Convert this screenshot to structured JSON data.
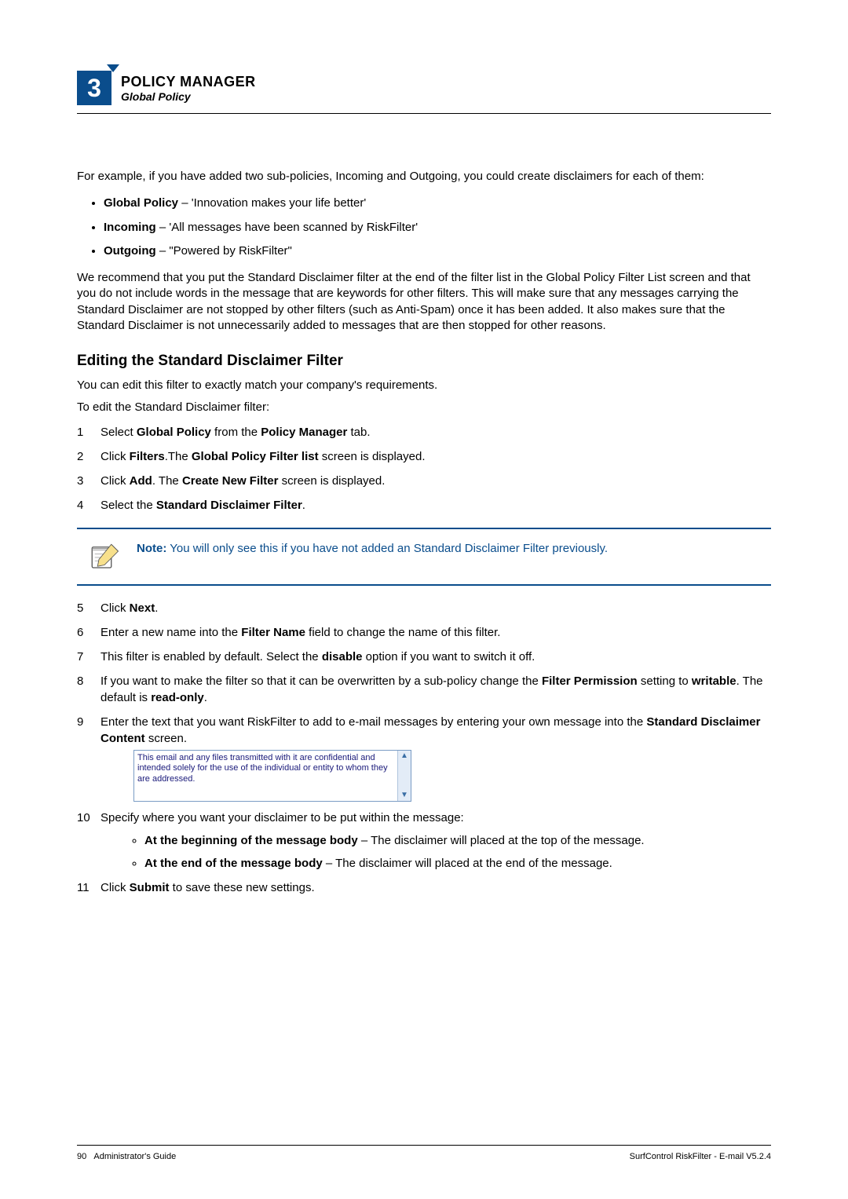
{
  "header": {
    "chapter_number": "3",
    "title": "POLICY MANAGER",
    "subtitle": "Global Policy"
  },
  "intro_para": "For example, if you have added two sub-policies, Incoming and Outgoing, you could create disclaimers for each of them:",
  "bullets1": [
    {
      "bold": "Global Policy",
      "rest": " – 'Innovation makes your life better'"
    },
    {
      "bold": "Incoming",
      "rest": " – 'All messages have been scanned by RiskFilter'"
    },
    {
      "bold": "Outgoing",
      "rest": " – \"Powered by RiskFilter\""
    }
  ],
  "para2": "We recommend that you put the Standard Disclaimer filter at the end of the filter list in the Global Policy Filter List screen and that you do not include words in the message that are keywords for other filters. This will make sure that any messages carrying the Standard Disclaimer are not stopped by other filters (such as Anti-Spam) once it has been added. It also makes sure that the Standard Disclaimer is not unnecessarily added to messages that are then stopped for other reasons.",
  "h2": "Editing the Standard Disclaimer Filter",
  "para3": "You can edit this filter to exactly match your company's requirements.",
  "para4": "To edit the Standard Disclaimer filter:",
  "steps_a": {
    "s1_pre": "Select ",
    "s1_b1": "Global Policy",
    "s1_mid": " from the ",
    "s1_b2": "Policy Manager",
    "s1_post": " tab.",
    "s2_pre": "Click ",
    "s2_b1": "Filters",
    "s2_mid": ".The ",
    "s2_b2": "Global Policy Filter list",
    "s2_post": " screen is displayed.",
    "s3_pre": "Click ",
    "s3_b1": "Add",
    "s3_mid": ". The ",
    "s3_b2": "Create New Filter",
    "s3_post": " screen is displayed.",
    "s4_pre": "Select the ",
    "s4_b1": "Standard Disclaimer Filter",
    "s4_post": "."
  },
  "note": {
    "label": "Note:",
    "text": " You will only see this if you have not added an Standard Disclaimer Filter previously."
  },
  "steps_b": {
    "s5_pre": "Click ",
    "s5_b1": "Next",
    "s5_post": ".",
    "s6_pre": "Enter a new name into the ",
    "s6_b1": "Filter Name",
    "s6_post": " field to change the name of this filter.",
    "s7_pre": "This filter is enabled by default. Select the ",
    "s7_b1": "disable",
    "s7_post": " option if you want to switch it off.",
    "s8_pre": "If you want to make the filter so that it can be overwritten by a sub-policy change the ",
    "s8_b1": "Filter Permission",
    "s8_mid": " setting to ",
    "s8_b2": "writable",
    "s8_mid2": ". The default is ",
    "s8_b3": "read-only",
    "s8_post": ".",
    "s9_pre": "Enter the text that you want RiskFilter to add to e-mail messages by entering your own message into the ",
    "s9_b1": "Standard Disclaimer Content",
    "s9_post": " screen."
  },
  "textarea_content": "This email and any files transmitted with it are confidential and intended solely for the use of the individual or entity to whom they are addressed.",
  "steps_c": {
    "s10": "Specify where you want your disclaimer to be put within the message:",
    "s10_sub": [
      {
        "bold": "At the beginning of the message body",
        "rest": " – The disclaimer will placed at the top of the message."
      },
      {
        "bold": "At the end of the message body",
        "rest": " – The disclaimer will placed at the end of the message."
      }
    ],
    "s11_pre": "Click ",
    "s11_b1": "Submit",
    "s11_post": " to save these new settings."
  },
  "footer": {
    "page_num": "90",
    "left": "Administrator's Guide",
    "right": "SurfControl RiskFilter - E-mail V5.2.4"
  }
}
